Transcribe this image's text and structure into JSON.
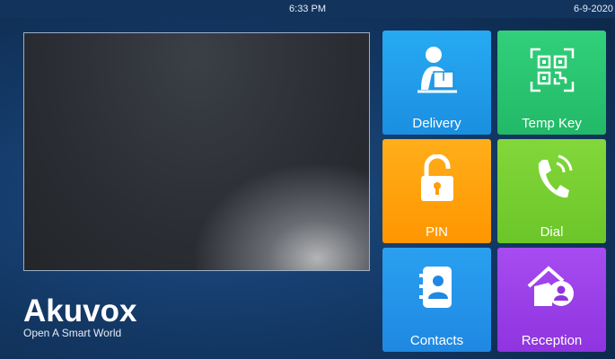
{
  "status_bar": {
    "time": "6:33 PM",
    "date": "6-9-2020"
  },
  "brand": {
    "name": "Akuvox",
    "tagline": "Open A Smart World"
  },
  "tiles": [
    {
      "label": "Delivery",
      "icon": "delivery-person-icon",
      "color": "#1f98e8"
    },
    {
      "label": "Temp Key",
      "icon": "qr-code-icon",
      "color": "#28c26f"
    },
    {
      "label": "PIN",
      "icon": "unlocked-padlock-icon",
      "color": "#ffa20c"
    },
    {
      "label": "Dial",
      "icon": "phone-ringing-icon",
      "color": "#77cd31"
    },
    {
      "label": "Contacts",
      "icon": "contact-book-icon",
      "color": "#2494e9"
    },
    {
      "label": "Reception",
      "icon": "house-person-icon",
      "color": "#9a40e6"
    }
  ]
}
